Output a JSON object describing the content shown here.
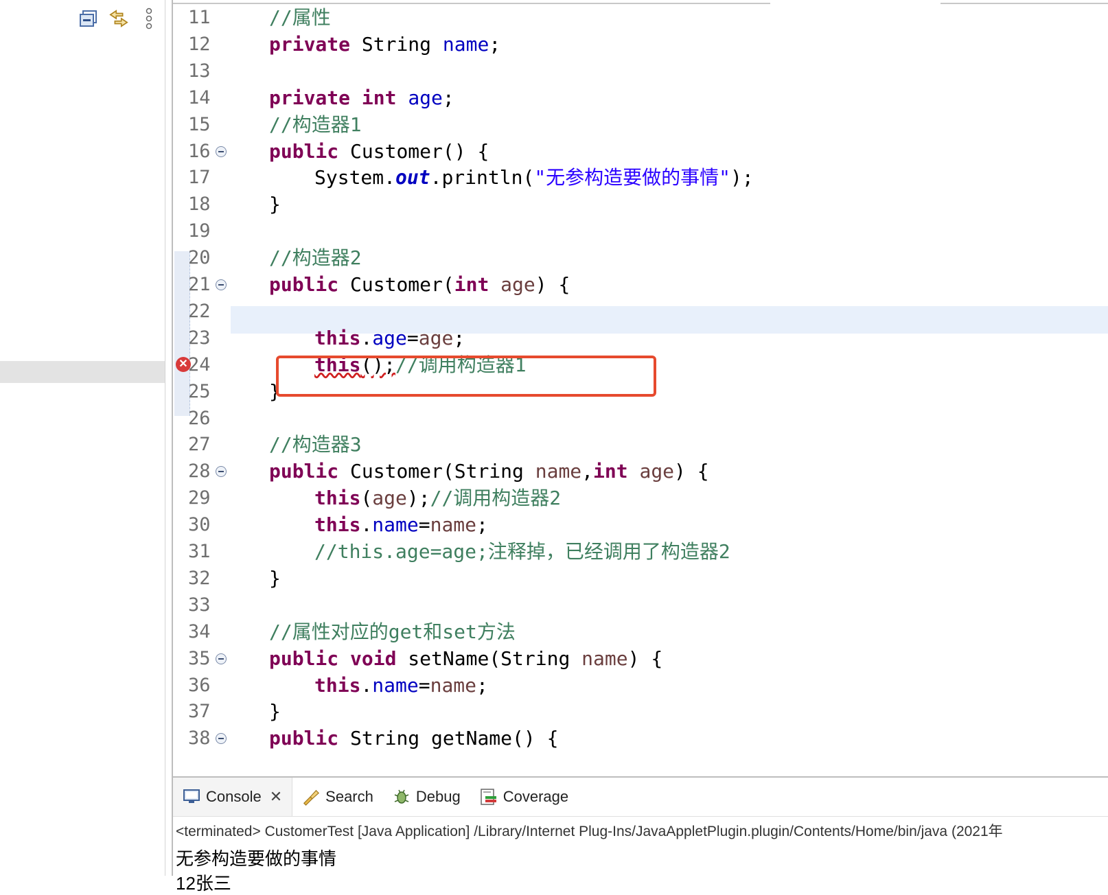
{
  "left_toolbar": {
    "icons": [
      "collapse-all-icon",
      "link-with-editor-icon",
      "view-menu-icon"
    ]
  },
  "editor": {
    "lines": [
      {
        "n": "11",
        "fold": false,
        "error": false
      },
      {
        "n": "12",
        "fold": false,
        "error": false
      },
      {
        "n": "13",
        "fold": false,
        "error": false
      },
      {
        "n": "14",
        "fold": false,
        "error": false
      },
      {
        "n": "15",
        "fold": false,
        "error": false
      },
      {
        "n": "16",
        "fold": true,
        "error": false
      },
      {
        "n": "17",
        "fold": false,
        "error": false
      },
      {
        "n": "18",
        "fold": false,
        "error": false
      },
      {
        "n": "19",
        "fold": false,
        "error": false
      },
      {
        "n": "20",
        "fold": false,
        "error": false
      },
      {
        "n": "21",
        "fold": true,
        "error": false
      },
      {
        "n": "22",
        "fold": false,
        "error": false
      },
      {
        "n": "23",
        "fold": false,
        "error": false
      },
      {
        "n": "24",
        "fold": false,
        "error": true
      },
      {
        "n": "25",
        "fold": false,
        "error": false
      },
      {
        "n": "26",
        "fold": false,
        "error": false
      },
      {
        "n": "27",
        "fold": false,
        "error": false
      },
      {
        "n": "28",
        "fold": true,
        "error": false
      },
      {
        "n": "29",
        "fold": false,
        "error": false
      },
      {
        "n": "30",
        "fold": false,
        "error": false
      },
      {
        "n": "31",
        "fold": false,
        "error": false
      },
      {
        "n": "32",
        "fold": false,
        "error": false
      },
      {
        "n": "33",
        "fold": false,
        "error": false
      },
      {
        "n": "34",
        "fold": false,
        "error": false
      },
      {
        "n": "35",
        "fold": true,
        "error": false
      },
      {
        "n": "36",
        "fold": false,
        "error": false
      },
      {
        "n": "37",
        "fold": false,
        "error": false
      },
      {
        "n": "38",
        "fold": true,
        "error": false
      }
    ],
    "code": {
      "l11_comment": "//属性",
      "l12_kw": "private",
      "l12_type": " String ",
      "l12_field": "name",
      "l12_end": ";",
      "l14_kw1": "private",
      "l14_kw2": "int",
      "l14_field": "age",
      "l14_end": ";",
      "l15_comment": "//构造器1",
      "l16_kw": "public",
      "l16_rest": " Customer() {",
      "l17_a": "System.",
      "l17_out": "out",
      "l17_b": ".println(",
      "l17_str": "\"无参构造要做的事情\"",
      "l17_c": ");",
      "l18": "}",
      "l20_comment": "//构造器2",
      "l21_kw": "public",
      "l21_a": " Customer(",
      "l21_kw2": "int",
      "l21_param": " age",
      "l21_b": ") {",
      "l23_kw": "this",
      "l23_dot": ".",
      "l23_field": "age",
      "l23_eq": "=",
      "l23_param": "age",
      "l23_end": ";",
      "l24_kw": "this",
      "l24_call": "();",
      "l24_comment": "//调用构造器1",
      "l25": "}",
      "l27_comment": "//构造器3",
      "l28_kw": "public",
      "l28_a": " Customer(String ",
      "l28_p1": "name",
      "l28_comma": ",",
      "l28_kw2": "int",
      "l28_p2": " age",
      "l28_b": ") {",
      "l29_kw": "this",
      "l29_a": "(",
      "l29_param": "age",
      "l29_b": ");",
      "l29_comment": "//调用构造器2",
      "l30_kw": "this",
      "l30_dot": ".",
      "l30_field": "name",
      "l30_eq": "=",
      "l30_param": "name",
      "l30_end": ";",
      "l31_comment": "//this.age=age;注释掉，已经调用了构造器2",
      "l32": "}",
      "l34_comment": "//属性对应的get和set方法",
      "l35_kw": "public",
      "l35_kw2": "void",
      "l35_a": " setName(String ",
      "l35_param": "name",
      "l35_b": ") {",
      "l36_kw": "this",
      "l36_dot": ".",
      "l36_field": "name",
      "l36_eq": "=",
      "l36_param": "name",
      "l36_end": ";",
      "l37": "}",
      "l38_kw": "public",
      "l38_rest": " String getName() {"
    }
  },
  "console": {
    "tabs": {
      "console": "Console",
      "search": "Search",
      "debug": "Debug",
      "coverage": "Coverage"
    },
    "status": "<terminated> CustomerTest [Java Application] /Library/Internet Plug-Ins/JavaAppletPlugin.plugin/Contents/Home/bin/java  (2021年",
    "output_line1": "无参构造要做的事情",
    "output_line2": "12张三"
  },
  "colors": {
    "keyword": "#7f0055",
    "comment": "#3f7f5f",
    "field": "#0000c0",
    "string": "#2a00ff",
    "highlight_box": "#e64a2e",
    "current_line": "#e8f0fb"
  }
}
